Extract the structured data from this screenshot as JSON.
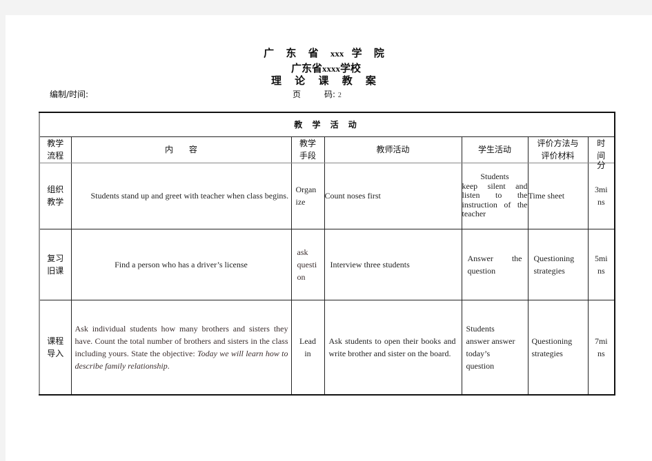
{
  "header": {
    "title_line1_prefix": "广 东 省",
    "title_line1_school": "xxx",
    "title_line1_suffix": "学 院",
    "title_line2_prefix": "广东省",
    "title_line2_school": "xxxx",
    "title_line2_suffix": "学校",
    "title_line3": "理 论 课 教 案",
    "compile_time_label": "编制/时间:",
    "page_label": "页",
    "page_code_label": "码:",
    "page_number": "2"
  },
  "table": {
    "section_title": "教 学 活 动",
    "columns": [
      {
        "line1": "教学",
        "line2": "流程"
      },
      {
        "label": "内      容"
      },
      {
        "line1": "教学",
        "line2": "手段"
      },
      {
        "label": "教师活动"
      },
      {
        "label": "学生活动"
      },
      {
        "line1": "评价方法与",
        "line2": "评价材料"
      },
      {
        "line1": "时",
        "line2": "间",
        "line3": "分"
      }
    ],
    "rows": [
      {
        "stage_line1": "组织",
        "stage_line2": "教学",
        "content": "Students stand up and greet with teacher when class begins.",
        "means": "Organize",
        "means_line1": "Organ",
        "means_line2": "ize",
        "teacher": "Count noses first",
        "student_line1": "Students",
        "student_rest": "keep silent and listen to the instruction of the teacher",
        "evaluation": "Time sheet",
        "time_line1": "3mi",
        "time_line2": "ns"
      },
      {
        "stage_line1": "复习",
        "stage_line2": "旧课",
        "content": "Find a person who has a driver’s license",
        "means_line1": "ask",
        "means_line2": "questi",
        "means_line3": "on",
        "teacher": "Interview three students",
        "student": "Answer the question",
        "evaluation": "Questioning strategies",
        "time_line1": "5mi",
        "time_line2": "ns"
      },
      {
        "stage_line1": "课程",
        "stage_line2": "导入",
        "content_plain": "Ask individual students how many brothers and sisters they have. Count the total number of brothers and sisters in the class including yours. State the objective: ",
        "content_italic": "Today we will learn how to describe family relationship",
        "content_end": ".",
        "means_line1": "Lead",
        "means_line2": "in",
        "teacher": "Ask students to open their books and write brother and sister on the board.",
        "student_line1": "Students",
        "student_line2": "answer answer",
        "student_line3": "today’s",
        "student_line4": "question",
        "evaluation": "Questioning strategies",
        "time_line1": "7mi",
        "time_line2": "ns"
      }
    ]
  }
}
